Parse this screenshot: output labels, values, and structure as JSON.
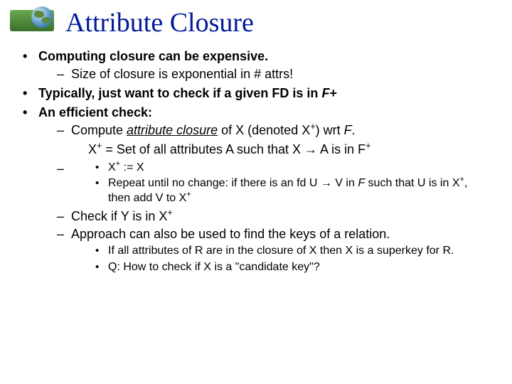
{
  "title": "Attribute Closure",
  "b1": {
    "head": "Computing closure can be expensive.",
    "s1": "Size of closure is exponential in # attrs!"
  },
  "b2": {
    "pre": "Typically, just want to check if a given FD is in ",
    "em": "F",
    "post": "+"
  },
  "b3": {
    "head": "An efficient check:",
    "compute_pre": "Compute ",
    "compute_attr": "attribute closure",
    "compute_mid": " of X (denoted X",
    "compute_sup": "+",
    "compute_post": ") wrt ",
    "compute_em": "F",
    "compute_end": ".",
    "eq_left": "X",
    "eq_sup": "+",
    "eq_txt": " =  Set of all attributes A such that X ",
    "eq_arrow": "→",
    "eq_tail": " A is in F",
    "eq_tail_sup": "+",
    "alg1_left": "X",
    "alg1_sup": "+",
    "alg1_txt": " := X",
    "alg2_pre": "Repeat until no change: if there is an fd U ",
    "alg2_arrow": "→",
    "alg2_mid": " V in ",
    "alg2_em": "F",
    "alg2_post": "  such that U is in X",
    "alg2_sup": "+",
    "alg2_tail": ", then add V to X",
    "alg2_sup2": "+",
    "check_pre": "Check if Y is in X",
    "check_sup": "+",
    "approach": "Approach can also be used to find the keys of a relation.",
    "key1": "If all attributes of R are in the closure of X then X is a superkey for R.",
    "key2": "Q: How to check if X is a \"candidate key\"?"
  }
}
